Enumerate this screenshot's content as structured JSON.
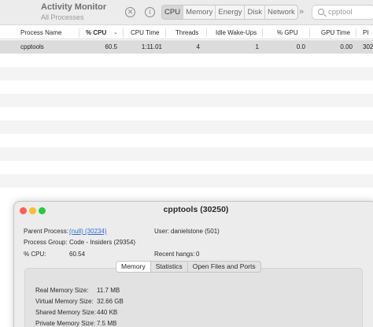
{
  "app": {
    "title": "Activity Monitor",
    "subtitle": "All Processes"
  },
  "toolbar": {
    "stop_icon": "close-circle-icon",
    "info_icon": "info-circle-icon",
    "tabs": [
      {
        "label": "CPU",
        "active": true
      },
      {
        "label": "Memory",
        "active": false
      },
      {
        "label": "Energy",
        "active": false
      },
      {
        "label": "Disk",
        "active": false
      },
      {
        "label": "Network",
        "active": false
      }
    ],
    "more_label": "»",
    "search_value": "cpptool"
  },
  "columns": [
    {
      "label": "Process Name"
    },
    {
      "label": "% CPU",
      "sorted": true
    },
    {
      "label": "CPU Time"
    },
    {
      "label": "Threads"
    },
    {
      "label": "Idle Wake-Ups"
    },
    {
      "label": "% GPU"
    },
    {
      "label": "GPU Time"
    },
    {
      "label": "PI"
    }
  ],
  "rows": [
    {
      "name": "cpptools",
      "cpu": "60.5",
      "cpu_time": "1:11.01",
      "threads": "4",
      "idle_wakeups": "1",
      "gpu": "0.0",
      "gpu_time": "0.00",
      "pid": "302"
    }
  ],
  "info_window": {
    "title": "cpptools (30250)",
    "fields": {
      "parent_process_label": "Parent Process:",
      "parent_process_value": "(null) (30234)",
      "user_label": "User:",
      "user_value": "danielstone (501)",
      "process_group_label": "Process Group:",
      "process_group_value": "Code - Insiders (29354)",
      "cpu_label": "% CPU:",
      "cpu_value": "60.54",
      "recent_hangs_label": "Recent hangs:",
      "recent_hangs_value": "0"
    },
    "tabs": [
      {
        "label": "Memory",
        "active": true
      },
      {
        "label": "Statistics",
        "active": false
      },
      {
        "label": "Open Files and Ports",
        "active": false
      }
    ],
    "memory": [
      {
        "label": "Real Memory Size:",
        "value": "11.7 MB"
      },
      {
        "label": "Virtual Memory Size:",
        "value": "32.66 GB"
      },
      {
        "label": "Shared Memory Size:",
        "value": "440 KB"
      },
      {
        "label": "Private Memory Size:",
        "value": "7.5 MB"
      }
    ]
  },
  "colors": {
    "close": "#fe5f57",
    "minimize": "#febc2e",
    "zoom": "#28c840",
    "link": "#2f6fd6",
    "selected_row": "#dcdcdc"
  }
}
